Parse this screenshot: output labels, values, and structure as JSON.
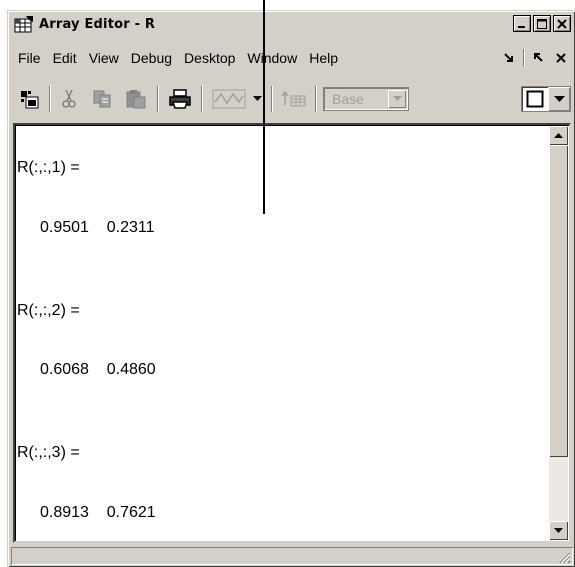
{
  "window": {
    "title": "Array Editor - R"
  },
  "menu": {
    "items": [
      "File",
      "Edit",
      "View",
      "Debug",
      "Desktop",
      "Window",
      "Help"
    ]
  },
  "toolbar": {
    "base_select": {
      "selected": "Base"
    }
  },
  "output": {
    "blocks": [
      {
        "label": "R(:,:,1) =",
        "values": "0.9501    0.2311"
      },
      {
        "label": "R(:,:,2) =",
        "values": "0.6068    0.4860"
      },
      {
        "label": "R(:,:,3) =",
        "values": "0.8913    0.7621"
      }
    ]
  },
  "icons": {
    "window_icon": "array-editor-icon",
    "minimize": "minimize-icon",
    "maximize": "maximize-icon",
    "close": "close-icon",
    "dock": "dock-arrow-icon",
    "undock": "undock-arrow-icon",
    "menu_close": "close-x-icon",
    "import": "import-data-icon",
    "cut": "cut-icon",
    "copy": "copy-icon",
    "paste": "paste-icon",
    "print": "print-icon",
    "plot": "plot-selection-icon",
    "plot_dropdown": "chevron-down-icon",
    "stack": "stack-base-icon",
    "format": "format-square-icon"
  }
}
